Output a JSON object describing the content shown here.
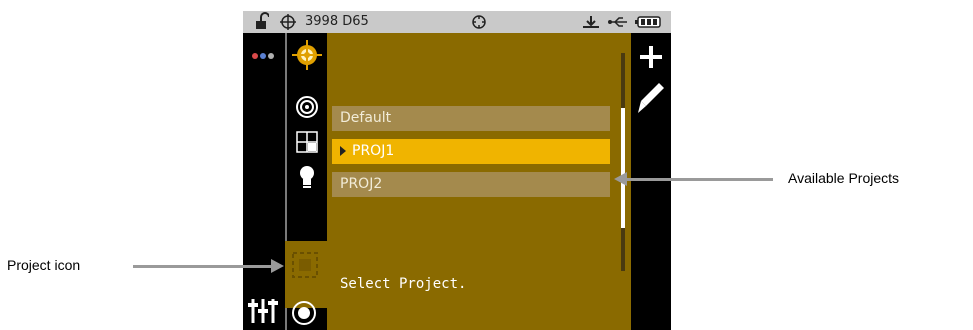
{
  "status": {
    "lock_icon": "lock-open-icon",
    "target_icon": "crosshair-icon",
    "label": "3998 D65",
    "center_icon": "aperture-icon",
    "usb_icon": "usb-icon",
    "battery_icon": "battery-icon"
  },
  "left_rail": {
    "top_icon": "color-dots-icon",
    "bottom_icon": "sliders-icon",
    "dot_colors": [
      "#d94a4a",
      "#5a7fd0",
      "#b0b0b0"
    ]
  },
  "tools": {
    "items": [
      "target-selected-icon",
      "aperture-ring-icon",
      "grid-icon",
      "lightbulb-icon"
    ],
    "project_icon": "project-icon",
    "measure_icon": "measure-ring-icon"
  },
  "projects": {
    "items": [
      {
        "label": "Default",
        "selected": false
      },
      {
        "label": "PROJ1",
        "selected": true
      },
      {
        "label": "PROJ2",
        "selected": false
      }
    ],
    "prompt": "Select Project."
  },
  "right_rail": {
    "add_icon": "plus-icon",
    "edit_icon": "pencil-icon"
  },
  "callouts": {
    "available_projects": "Available Projects",
    "project_icon": "Project icon"
  },
  "colors": {
    "panel": "#8a6a00",
    "selected": "#f0b400",
    "item": "#a48a4d",
    "status_bg": "#c9c9c9",
    "target_orange": "#e0a000"
  }
}
